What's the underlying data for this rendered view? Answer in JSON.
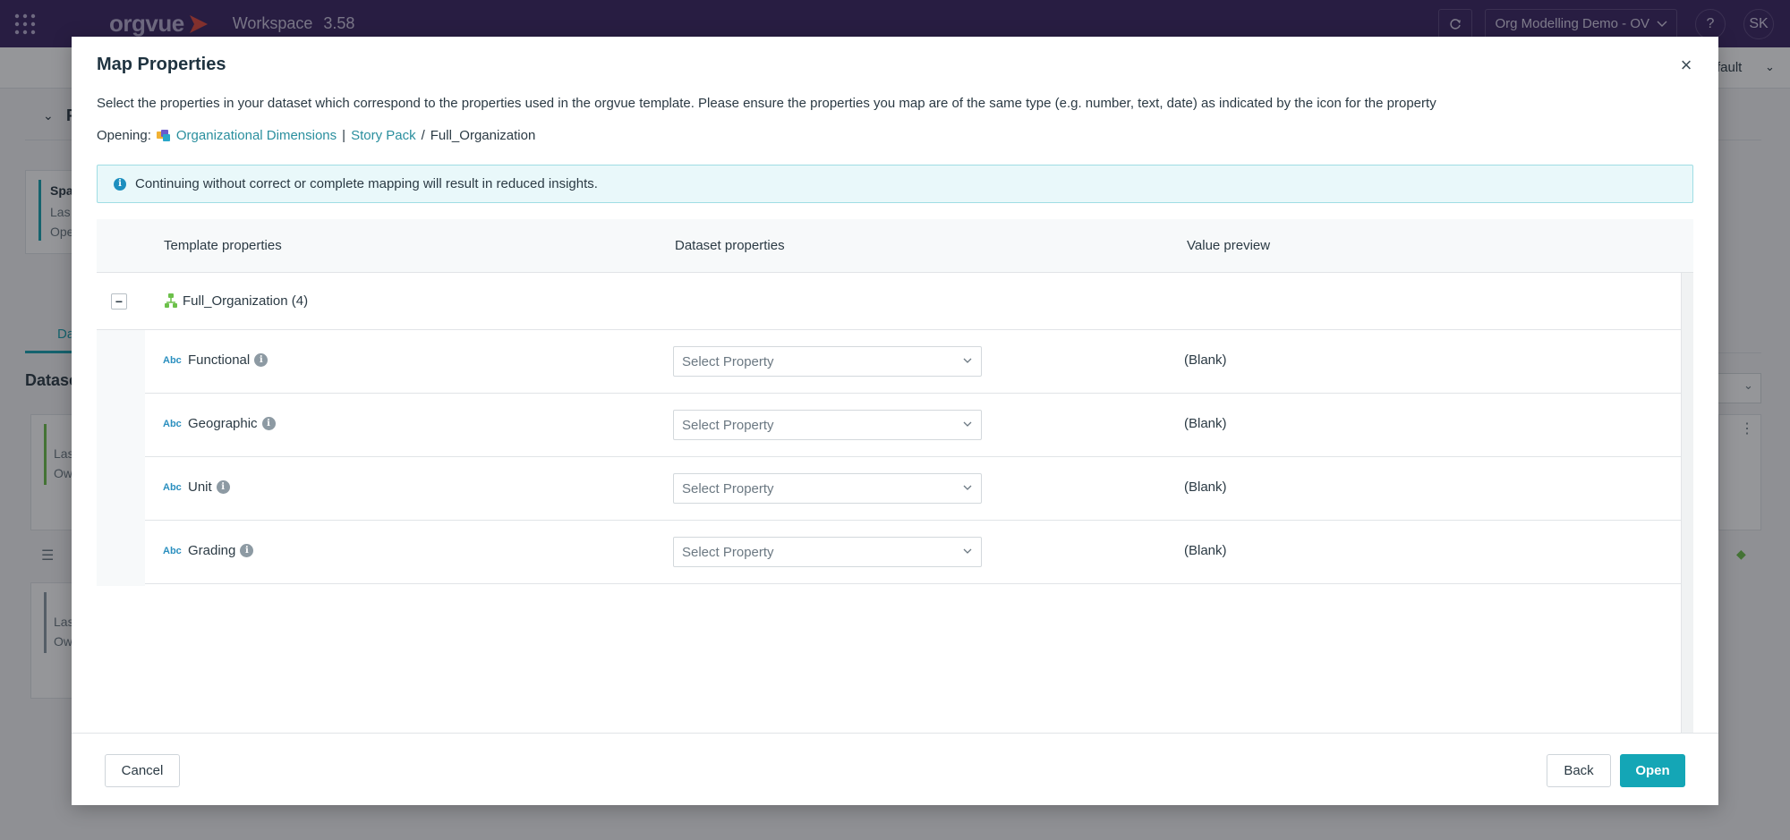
{
  "app": {
    "brand": "orgvue",
    "workspace_label": "Workspace",
    "version": "3.58",
    "org_selector": "Org Modelling Demo - OV",
    "help_label": "?",
    "user_initials": "SK"
  },
  "background": {
    "default_label": "fault",
    "section_letter": "P",
    "card1": {
      "title": "Spa",
      "line1": "Las",
      "line2": "Ope"
    },
    "tab_label": "Da",
    "datasets_heading": "Datase",
    "card2": {
      "line1": "Las",
      "line2": "Ow"
    },
    "card3": {
      "line1": "Las",
      "line2": "Ow"
    }
  },
  "modal": {
    "title": "Map Properties",
    "close_label": "×",
    "description": "Select the properties in your dataset which correspond to the properties used in the orgvue template. Please ensure the properties you map are of the same type (e.g. number, text, date) as indicated by the icon for the property",
    "opening": {
      "label": "Opening:",
      "dimension": "Organizational Dimensions",
      "divider": "|",
      "pack": "Story Pack",
      "slash": "/",
      "current": "Full_Organization"
    },
    "alert": {
      "icon": "i",
      "text": "Continuing without correct or complete mapping will result in reduced insights."
    },
    "table": {
      "headers": {
        "template": "Template properties",
        "dataset": "Dataset properties",
        "preview": "Value preview"
      },
      "group": {
        "toggle": "−",
        "label": "Full_Organization (4)"
      },
      "rows": [
        {
          "type": "Abc",
          "name": "Functional",
          "info": "i",
          "select": "Select Property",
          "preview": "(Blank)"
        },
        {
          "type": "Abc",
          "name": "Geographic",
          "info": "i",
          "select": "Select Property",
          "preview": "(Blank)"
        },
        {
          "type": "Abc",
          "name": "Unit",
          "info": "i",
          "select": "Select Property",
          "preview": "(Blank)"
        },
        {
          "type": "Abc",
          "name": "Grading",
          "info": "i",
          "select": "Select Property",
          "preview": "(Blank)"
        }
      ]
    },
    "footer": {
      "cancel": "Cancel",
      "back": "Back",
      "open": "Open"
    }
  },
  "colors": {
    "topbar": "#3a2462",
    "accent": "#14a6b6",
    "link": "#2a8f9e",
    "alert_bg": "#e9f8fa"
  }
}
